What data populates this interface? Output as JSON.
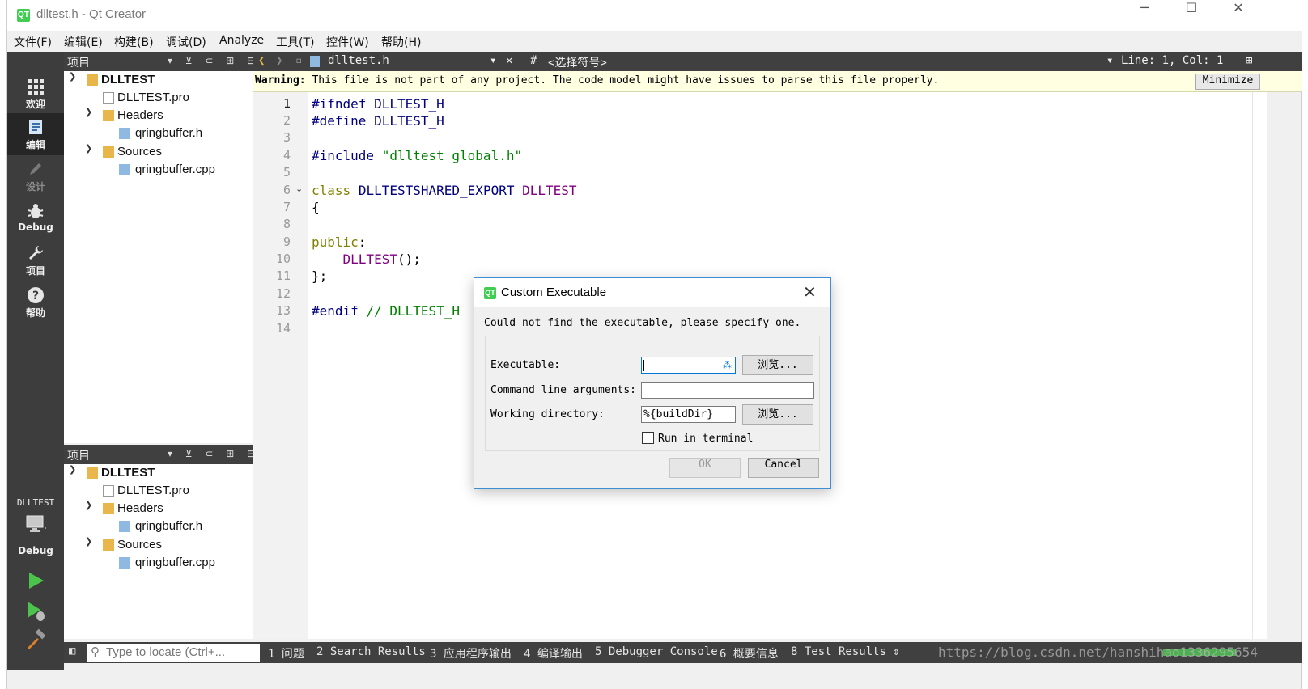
{
  "window": {
    "title": "dlltest.h - Qt Creator",
    "app_icon": "QT"
  },
  "menu": [
    "文件(F)",
    "编辑(E)",
    "构建(B)",
    "调试(D)",
    "Analyze",
    "工具(T)",
    "控件(W)",
    "帮助(H)"
  ],
  "modes": [
    {
      "label": "欢迎",
      "icon": "grid-icon"
    },
    {
      "label": "编辑",
      "icon": "edit-doc-icon"
    },
    {
      "label": "设计",
      "icon": "pencil-icon"
    },
    {
      "label": "Debug",
      "icon": "bug-icon"
    },
    {
      "label": "项目",
      "icon": "wrench-icon"
    },
    {
      "label": "帮助",
      "icon": "help-icon"
    }
  ],
  "kit": {
    "project": "DLLTEST",
    "mode": "Debug"
  },
  "project_panes": [
    {
      "header": "项目",
      "tree": [
        {
          "label": "DLLTEST",
          "kind": "project"
        },
        {
          "label": "DLLTEST.pro",
          "kind": "profile"
        },
        {
          "label": "Headers",
          "kind": "folder"
        },
        {
          "label": "qringbuffer.h",
          "kind": "file"
        },
        {
          "label": "Sources",
          "kind": "folder"
        },
        {
          "label": "qringbuffer.cpp",
          "kind": "file"
        }
      ]
    },
    {
      "header": "项目",
      "tree": [
        {
          "label": "DLLTEST",
          "kind": "project"
        },
        {
          "label": "DLLTEST.pro",
          "kind": "profile"
        },
        {
          "label": "Headers",
          "kind": "folder"
        },
        {
          "label": "qringbuffer.h",
          "kind": "file"
        },
        {
          "label": "Sources",
          "kind": "folder"
        },
        {
          "label": "qringbuffer.cpp",
          "kind": "file"
        }
      ]
    }
  ],
  "editor": {
    "file_name": "dlltest.h",
    "symbol_hash": "#",
    "symbol": "<选择符号>",
    "position": "Line: 1, Col: 1",
    "warning_label": "Warning:",
    "warning_text": "This file is not part of any project. The code model might have issues to parse this file properly.",
    "warning_button": "Minimize",
    "line_numbers": [
      "1",
      "2",
      "3",
      "4",
      "5",
      "6",
      "7",
      "8",
      "9",
      "10",
      "11",
      "12",
      "13",
      "14"
    ],
    "code": {
      "l1_pp": "#ifndef",
      "l1_rest": "DLLTEST_H",
      "l2_pp": "#define",
      "l2_rest": "DLLTEST_H",
      "l4_pp": "#include",
      "l4_str": "\"dlltest_global.h\"",
      "l6_kw": "class",
      "l6_mid": "DLLTESTSHARED_EXPORT",
      "l6_ty": "DLLTEST",
      "l7": "{",
      "l9_kw": "public",
      "l9_rest": ":",
      "l10_ty": "DLLTEST",
      "l10_rest": "();",
      "l11": "};",
      "l13_pp": "#endif",
      "l13_cm": "// DLLTEST_H"
    }
  },
  "status": {
    "locate_placeholder": "Type to locate (Ctrl+...",
    "tabs": [
      "1 问题",
      "2 Search Results",
      "3 应用程序输出",
      "4 编译输出",
      "5 Debugger Console",
      "6 概要信息",
      "8 Test Results"
    ],
    "watermark": "https://blog.csdn.net/hanshihao1336295654"
  },
  "dialog": {
    "title": "Custom Executable",
    "message": "Could not find the executable, please specify one.",
    "executable_label": "Executable:",
    "executable_value": "",
    "browse_label": "浏览...",
    "args_label": "Command line arguments:",
    "args_value": "",
    "workdir_label": "Working directory:",
    "workdir_value": "%{buildDir}",
    "run_in_terminal_label": "Run in terminal",
    "ok_label": "OK",
    "cancel_label": "Cancel"
  },
  "colors": {
    "keyword": "#808000",
    "preprocessor": "#000080",
    "string": "#008000",
    "type": "#800080",
    "qt_green": "#41cd52"
  }
}
